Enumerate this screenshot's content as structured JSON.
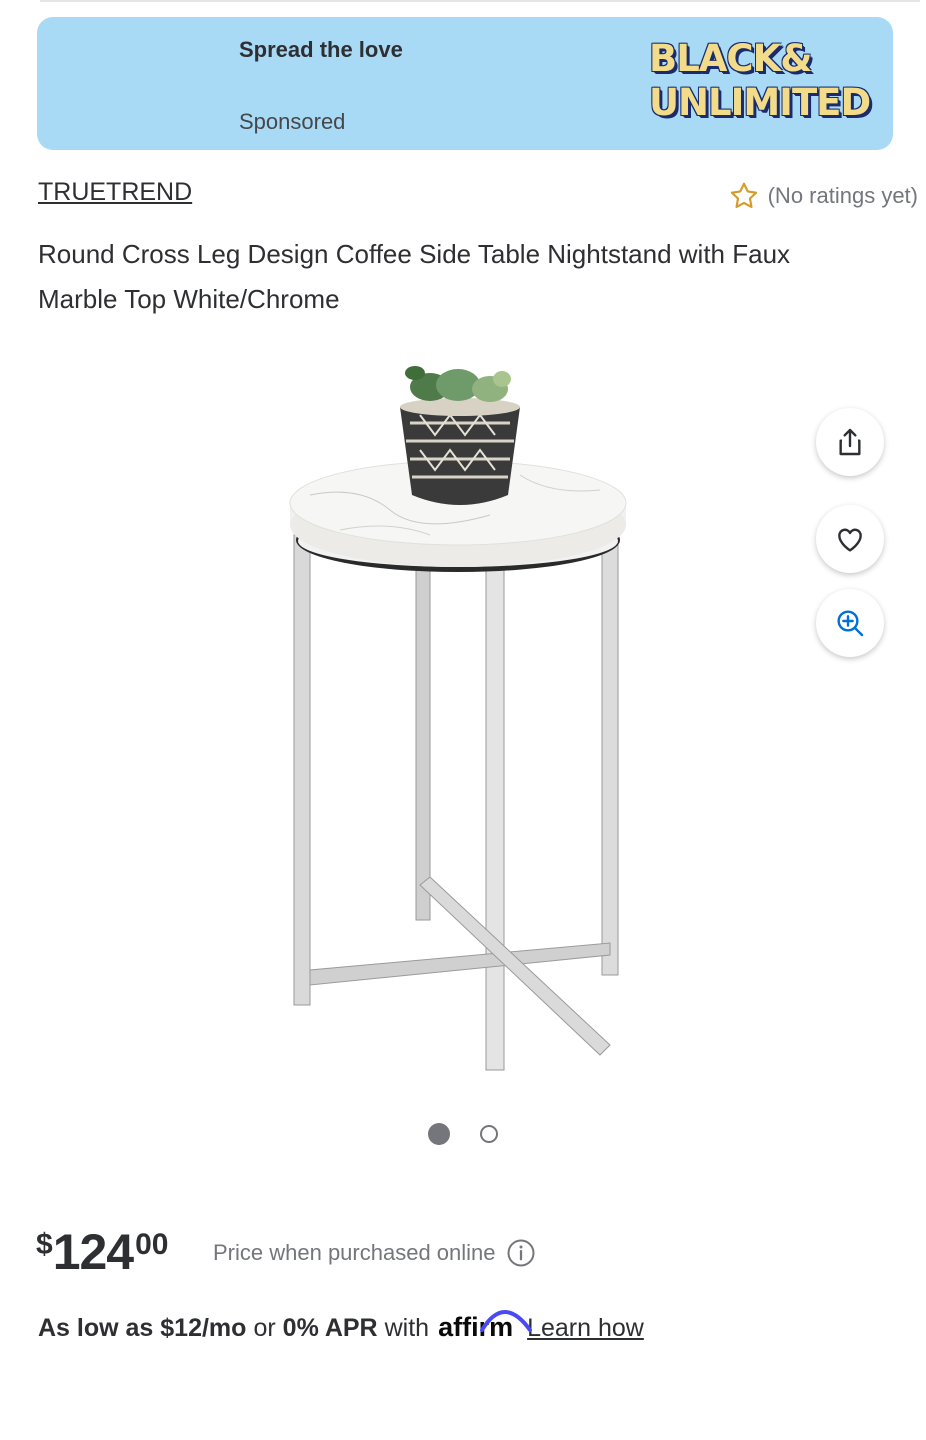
{
  "ad": {
    "headline": "Spread the love",
    "sponsored": "Sponsored",
    "logo_line1": "BLACK&",
    "logo_line2": "UNLIMITED",
    "bg_color": "#a9daf5"
  },
  "product": {
    "brand": "TRUETREND",
    "rating_text": "(No ratings yet)",
    "title": "Round Cross Leg Design Coffee Side Table Nightstand with Faux Marble Top White/Chrome",
    "image_icon": "side-table-photo",
    "carousel": {
      "total": 2,
      "active_index": 0
    }
  },
  "actions": {
    "share_icon": "share-icon",
    "favorite_icon": "heart-icon",
    "zoom_icon": "zoom-in-icon"
  },
  "price": {
    "currency": "$",
    "dollars": "124",
    "cents": "00",
    "note": "Price when purchased online"
  },
  "financing": {
    "part1_bold": "As low as $12/mo",
    "part2": "or",
    "part3_bold": "0% APR",
    "part4": "with",
    "brand": "affirm",
    "learn_how": "Learn how"
  }
}
